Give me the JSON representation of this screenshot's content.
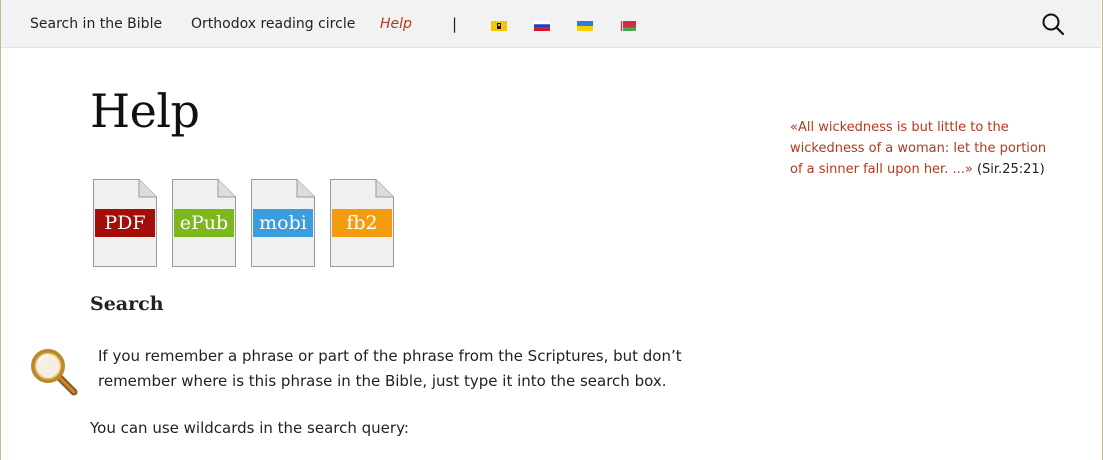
{
  "nav": {
    "items": [
      {
        "label": "Search in the Bible"
      },
      {
        "label": "Orthodox reading circle"
      },
      {
        "label": "Help"
      }
    ],
    "separator": "|",
    "languages": [
      "church-slavonic-flag-icon",
      "russian-flag-icon",
      "ukrainian-flag-icon",
      "belarusian-flag-icon"
    ],
    "search_icon": "search-icon"
  },
  "page": {
    "title": "Help",
    "downloads": [
      {
        "label": "PDF",
        "color": "#a30e0b"
      },
      {
        "label": "ePub",
        "color": "#7cb71d"
      },
      {
        "label": "mobi",
        "color": "#3d9ddc"
      },
      {
        "label": "fb2",
        "color": "#f39c0e"
      }
    ],
    "section_heading": "Search",
    "paragraph1": "If you remember a phrase or part of the phrase from the Scriptures, but don’t remember where is this phrase in the Bible, just type it into the search box.",
    "paragraph2": "You can use wildcards in the search query:"
  },
  "sidebar": {
    "quote_text": "«All wickedness is but little to the wickedness of a woman: let the portion of a sinner fall upon her. ...»",
    "quote_ref": "(Sir.25:21)"
  },
  "colors": {
    "accent": "#b2391c",
    "nav_bg": "#f2f2f2"
  }
}
